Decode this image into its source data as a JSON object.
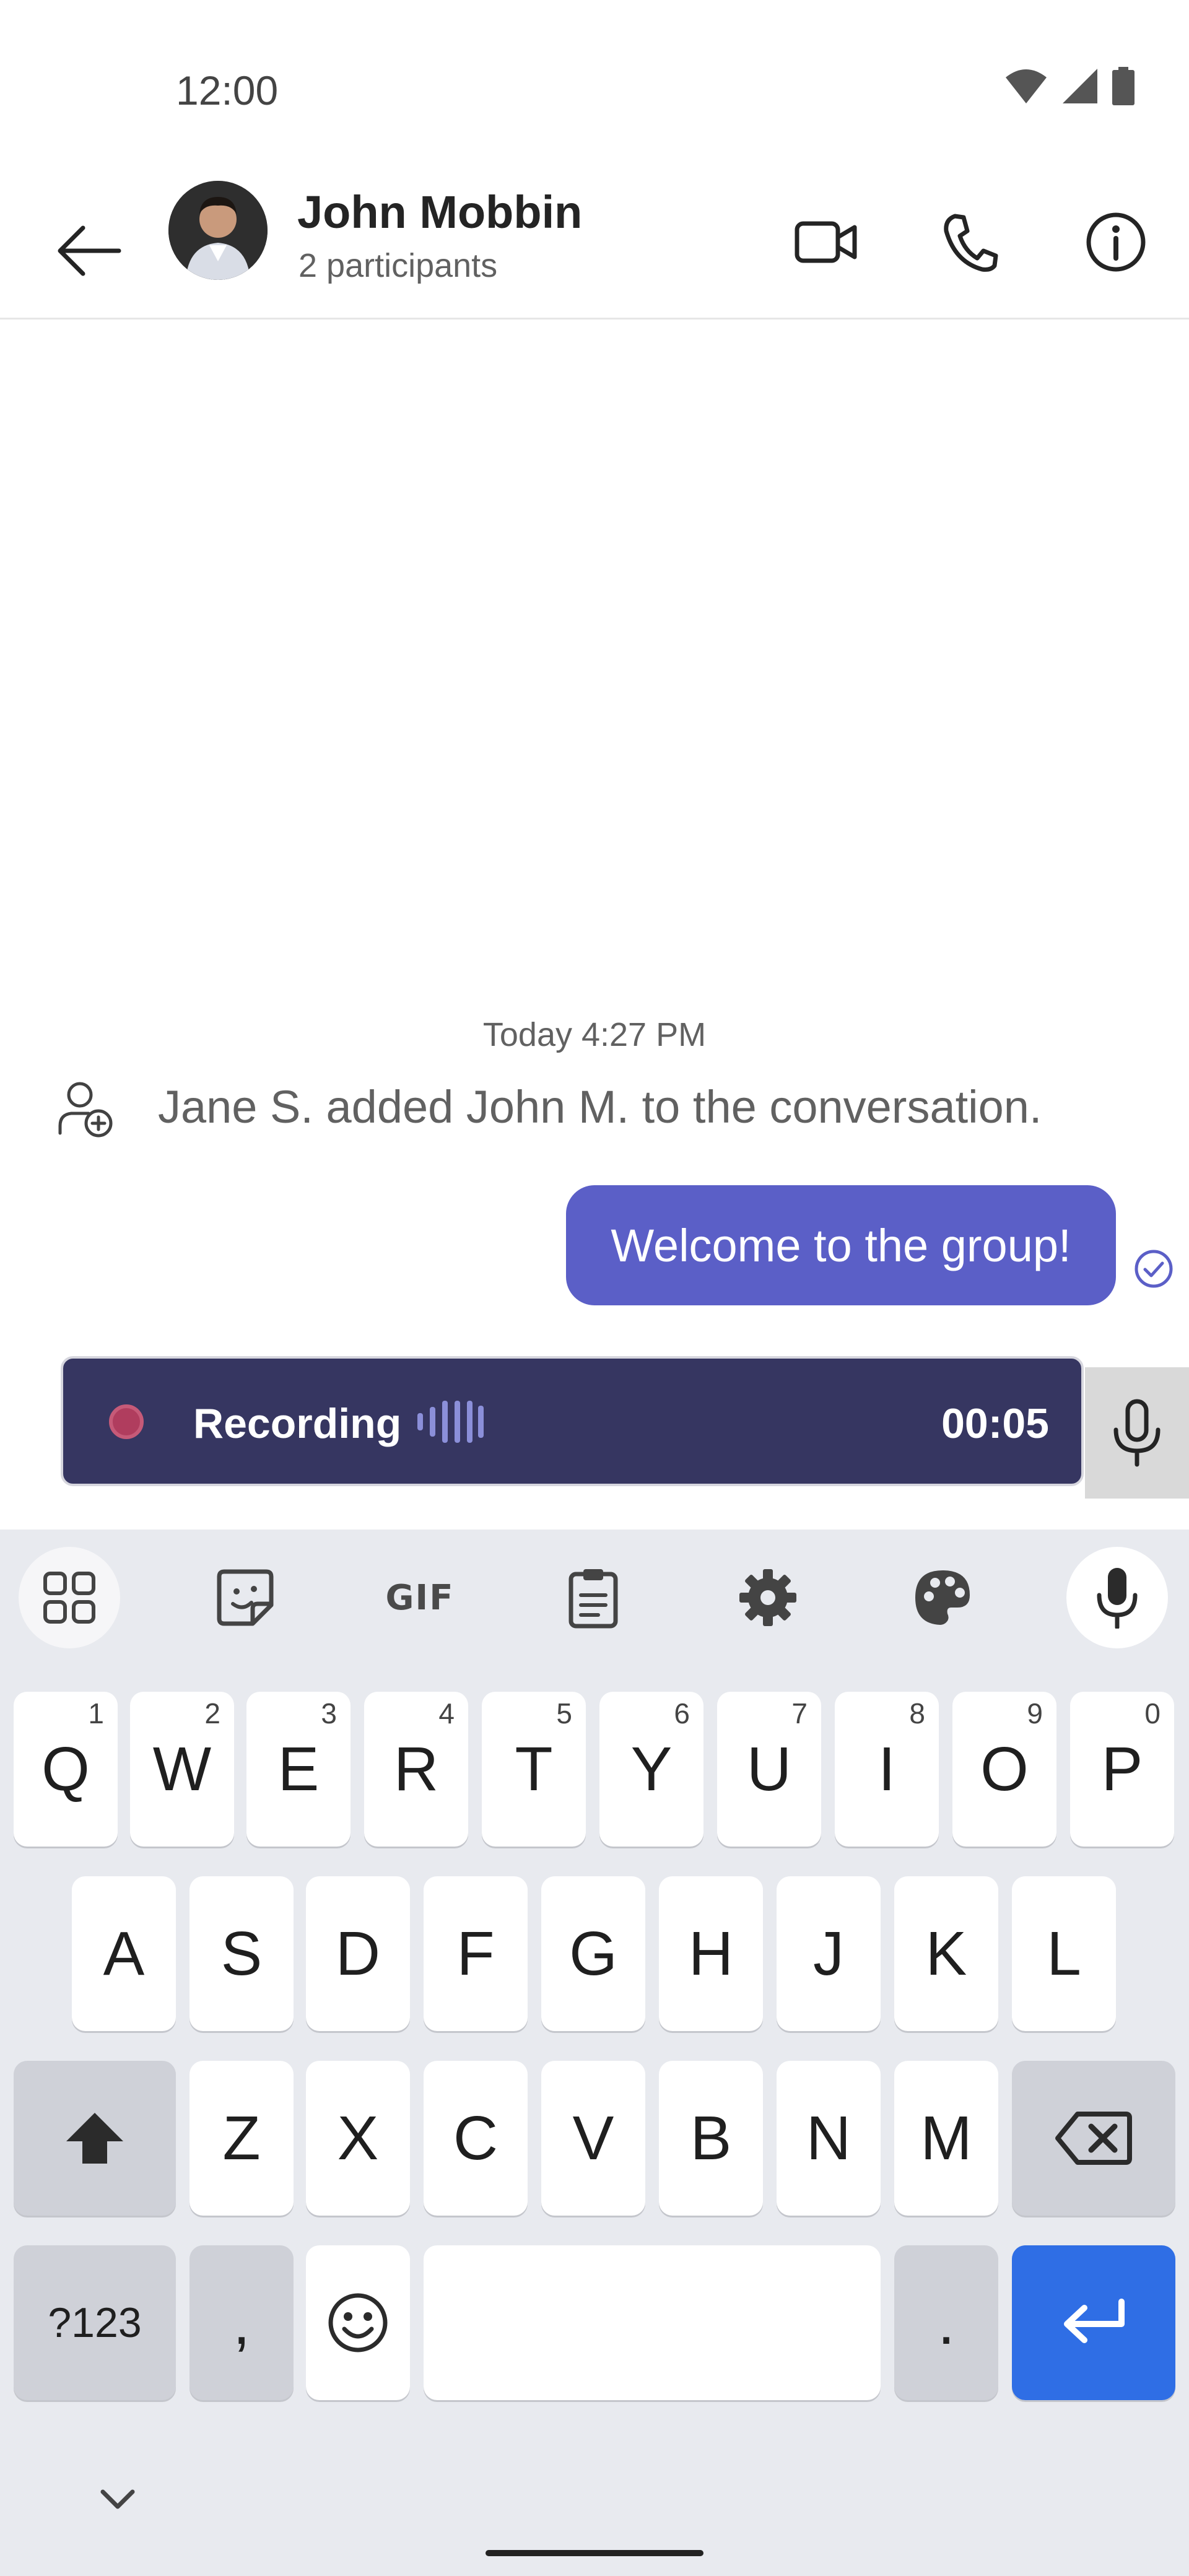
{
  "status_bar": {
    "time": "12:00"
  },
  "header": {
    "name": "John Mobbin",
    "subtitle": "2 participants"
  },
  "chat": {
    "timestamp": "Today 4:27 PM",
    "system_message": "Jane S. added John M. to the conversation.",
    "messages": [
      {
        "text": "Welcome to the group!",
        "status": "read"
      }
    ]
  },
  "recording": {
    "label": "Recording",
    "duration": "00:05"
  },
  "keyboard": {
    "toolbar": [
      "apps-grid-icon",
      "sticker-icon",
      "GIF",
      "clipboard-icon",
      "gear-icon",
      "palette-icon",
      "mic-icon"
    ],
    "gif_label": "GIF",
    "row1": [
      {
        "key": "Q",
        "hint": "1"
      },
      {
        "key": "W",
        "hint": "2"
      },
      {
        "key": "E",
        "hint": "3"
      },
      {
        "key": "R",
        "hint": "4"
      },
      {
        "key": "T",
        "hint": "5"
      },
      {
        "key": "Y",
        "hint": "6"
      },
      {
        "key": "U",
        "hint": "7"
      },
      {
        "key": "I",
        "hint": "8"
      },
      {
        "key": "O",
        "hint": "9"
      },
      {
        "key": "P",
        "hint": "0"
      }
    ],
    "row2": [
      "A",
      "S",
      "D",
      "F",
      "G",
      "H",
      "J",
      "K",
      "L"
    ],
    "row3": [
      "Z",
      "X",
      "C",
      "V",
      "B",
      "N",
      "M"
    ],
    "symbols_key": "?123",
    "comma_key": ",",
    "period_key": ".",
    "accent_color": "#2f6ee5"
  },
  "colors": {
    "bubble": "#5b5fc7",
    "recording_bar": "#363661",
    "recording_dot": "#b03d5e"
  }
}
